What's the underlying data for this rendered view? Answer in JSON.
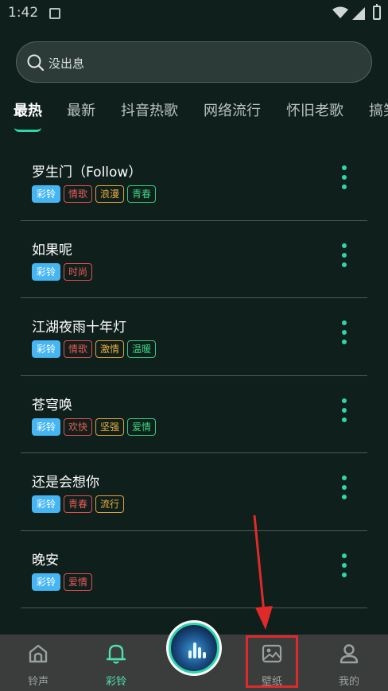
{
  "status": {
    "time": "1:42"
  },
  "search": {
    "placeholder": "没出息"
  },
  "tabs": [
    {
      "label": "最热",
      "active": true
    },
    {
      "label": "最新"
    },
    {
      "label": "抖音热歌"
    },
    {
      "label": "网络流行"
    },
    {
      "label": "怀旧老歌"
    },
    {
      "label": "搞笑"
    }
  ],
  "songs": [
    {
      "title": "罗生门（Follow）",
      "tags": [
        {
          "label": "彩铃",
          "style": "filled"
        },
        {
          "label": "情歌",
          "style": "red"
        },
        {
          "label": "浪漫",
          "style": "orange"
        },
        {
          "label": "青春",
          "style": "green"
        }
      ]
    },
    {
      "title": "如果呢",
      "tags": [
        {
          "label": "彩铃",
          "style": "filled"
        },
        {
          "label": "时尚",
          "style": "red"
        }
      ]
    },
    {
      "title": "江湖夜雨十年灯",
      "tags": [
        {
          "label": "彩铃",
          "style": "filled"
        },
        {
          "label": "情歌",
          "style": "red"
        },
        {
          "label": "激情",
          "style": "orange"
        },
        {
          "label": "温暖",
          "style": "green"
        }
      ]
    },
    {
      "title": "苍穹唤",
      "tags": [
        {
          "label": "彩铃",
          "style": "filled"
        },
        {
          "label": "欢快",
          "style": "red"
        },
        {
          "label": "坚强",
          "style": "orange"
        },
        {
          "label": "爱情",
          "style": "green"
        }
      ]
    },
    {
      "title": "还是会想你",
      "tags": [
        {
          "label": "彩铃",
          "style": "filled"
        },
        {
          "label": "青春",
          "style": "red"
        },
        {
          "label": "流行",
          "style": "orange"
        }
      ]
    },
    {
      "title": "晚安",
      "tags": [
        {
          "label": "彩铃",
          "style": "filled"
        },
        {
          "label": "爱情",
          "style": "red"
        }
      ]
    }
  ],
  "bottom_nav": [
    {
      "label": "铃声",
      "icon": "home-icon"
    },
    {
      "label": "彩铃",
      "icon": "bell-icon",
      "active": true
    },
    {
      "label": "壁纸",
      "icon": "image-icon"
    },
    {
      "label": "我的",
      "icon": "user-icon"
    }
  ],
  "colors": {
    "background": "#0f1f1b",
    "accent": "#2fd6a8",
    "tag_filled": "#46b6f2",
    "tag_red": "#e0504f",
    "tag_orange": "#dca23f",
    "tag_green": "#36c77a",
    "annotation": "#e02a2a"
  }
}
